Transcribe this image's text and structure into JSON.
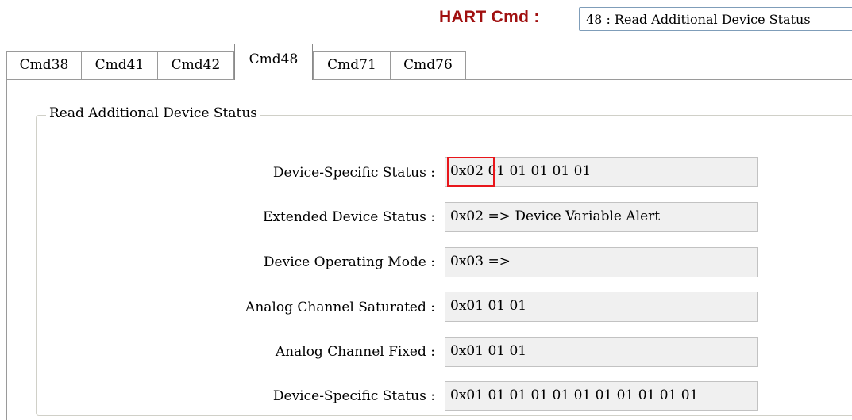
{
  "header": {
    "hart_cmd_label": "HART Cmd :",
    "selected_command": "48 : Read Additional Device Status"
  },
  "tabs": [
    {
      "label": "Cmd38"
    },
    {
      "label": "Cmd41"
    },
    {
      "label": "Cmd42"
    },
    {
      "label": "Cmd48",
      "active": true
    },
    {
      "label": "Cmd71"
    },
    {
      "label": "Cmd76"
    }
  ],
  "group": {
    "title": "Read Additional Device Status"
  },
  "rows": [
    {
      "label": "Device-Specific Status :",
      "value": "0x02 01 01 01 01 01"
    },
    {
      "label": "Extended Device Status :",
      "value": "0x02 => Device Variable Alert"
    },
    {
      "label": "Device Operating Mode :",
      "value": "0x03 =>"
    },
    {
      "label": "Analog Channel Saturated :",
      "value": "0x01 01 01"
    },
    {
      "label": "Analog Channel Fixed :",
      "value": "0x01 01 01"
    },
    {
      "label": "Device-Specific Status :",
      "value": "0x01 01 01 01 01 01 01 01 01 01 01"
    }
  ],
  "colors": {
    "hart_label": "#a01010",
    "highlight_box": "#e8161b",
    "field_bg": "#f0f0f0"
  }
}
